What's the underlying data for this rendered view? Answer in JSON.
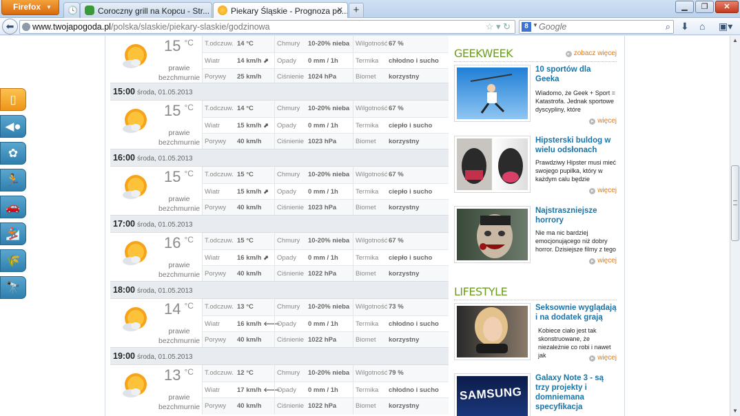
{
  "browser": {
    "menu_label": "Firefox",
    "tabs": [
      {
        "title": "Coroczny grill na Kopcu - Str...",
        "active": false
      },
      {
        "title": "Piekary Śląskie - Prognoza po...",
        "active": true
      }
    ],
    "url_domain": "www.twojapogoda.pl",
    "url_path": "/polska/slaskie/piekary-slaskie/godzinowa",
    "search_engine": "8",
    "search_placeholder": "Google"
  },
  "forecast": {
    "labels": {
      "feels": "T.odczuw.",
      "wind": "Wiatr",
      "gusts": "Porywy",
      "clouds": "Chmury",
      "precip": "Opady",
      "pressure": "Ciśnienie",
      "humidity": "Wilgotność",
      "thermal": "Termika",
      "biomet": "Biomet",
      "temp_unit": "°C",
      "condition_1": "prawie",
      "condition_2": "bezchmurnie"
    },
    "top_partial": {
      "temp": "15",
      "feels": "14 °C",
      "wind": "14 km/h",
      "wind_dir": "⬈",
      "gusts": "25 km/h",
      "clouds": "10-20% nieba",
      "precip": "0 mm / 1h",
      "pressure": "1024 hPa",
      "humidity": "67 %",
      "thermal": "chłodno i sucho",
      "biomet": "korzystny"
    },
    "hours": [
      {
        "time": "15:00",
        "date": "środa, 01.05.2013",
        "temp": "15",
        "feels": "14 °C",
        "wind": "15 km/h",
        "wind_dir": "⬈",
        "gusts": "40 km/h",
        "clouds": "10-20% nieba",
        "precip": "0 mm / 1h",
        "pressure": "1023 hPa",
        "humidity": "67 %",
        "thermal": "ciepło i sucho",
        "biomet": "korzystny"
      },
      {
        "time": "16:00",
        "date": "środa, 01.05.2013",
        "temp": "15",
        "feels": "15 °C",
        "wind": "15 km/h",
        "wind_dir": "⬈",
        "gusts": "40 km/h",
        "clouds": "10-20% nieba",
        "precip": "0 mm / 1h",
        "pressure": "1023 hPa",
        "humidity": "67 %",
        "thermal": "ciepło i sucho",
        "biomet": "korzystny"
      },
      {
        "time": "17:00",
        "date": "środa, 01.05.2013",
        "temp": "16",
        "feels": "15 °C",
        "wind": "16 km/h",
        "wind_dir": "⬈",
        "gusts": "40 km/h",
        "clouds": "10-20% nieba",
        "precip": "0 mm / 1h",
        "pressure": "1022 hPa",
        "humidity": "67 %",
        "thermal": "ciepło i sucho",
        "biomet": "korzystny"
      },
      {
        "time": "18:00",
        "date": "środa, 01.05.2013",
        "temp": "14",
        "feels": "13 °C",
        "wind": "16 km/h",
        "wind_dir": "🡐",
        "gusts": "40 km/h",
        "clouds": "10-20% nieba",
        "precip": "0 mm / 1h",
        "pressure": "1022 hPa",
        "humidity": "73 %",
        "thermal": "chłodno i sucho",
        "biomet": "korzystny"
      },
      {
        "time": "19:00",
        "date": "środa, 01.05.2013",
        "temp": "13",
        "feels": "12 °C",
        "wind": "17 km/h",
        "wind_dir": "🡐",
        "gusts": "40 km/h",
        "clouds": "10-20% nieba",
        "precip": "0 mm / 1h",
        "pressure": "1022 hPa",
        "humidity": "79 %",
        "thermal": "chłodno i sucho",
        "biomet": "korzystny"
      }
    ]
  },
  "sidebar_icons": [
    "phone-icon",
    "fish-icon",
    "pollen-icon",
    "runner-icon",
    "car-icon",
    "snowboard-icon",
    "wheat-icon",
    "telescope-icon"
  ],
  "geekweek": {
    "title": "GEEKWEEK",
    "more": "zobacz więcej",
    "articles": [
      {
        "title": "10 sportów dla Geeka",
        "desc": "Wiadomo, że Geek + Sport = Katastrofa. Jednak sportowe dyscypliny, które",
        "more": "więcej"
      },
      {
        "title": "Hipsterski buldog w wielu odsłonach",
        "desc": "Prawdziwy Hipster musi mieć swojego pupilka, który w każdym calu będzie",
        "more": "więcej"
      },
      {
        "title": "Najstraszniejsze horrory",
        "desc": "Nie ma nic bardziej emocjonującego niż dobry horror. Dzisiejsze filmy z tego",
        "more": "więcej"
      }
    ]
  },
  "lifestyle": {
    "title": "LIFESTYLE",
    "articles": [
      {
        "title": "Seksownie wyglądają i na dodatek grają",
        "desc": "Kobiece ciało jest tak skonstruowane, że niezależnie co robi i nawet jak",
        "more": "więcej"
      },
      {
        "title": "Galaxy Note 3 - są trzy projekty i domniemana specyfikacja",
        "img_text": "SAMSUNG"
      }
    ]
  }
}
